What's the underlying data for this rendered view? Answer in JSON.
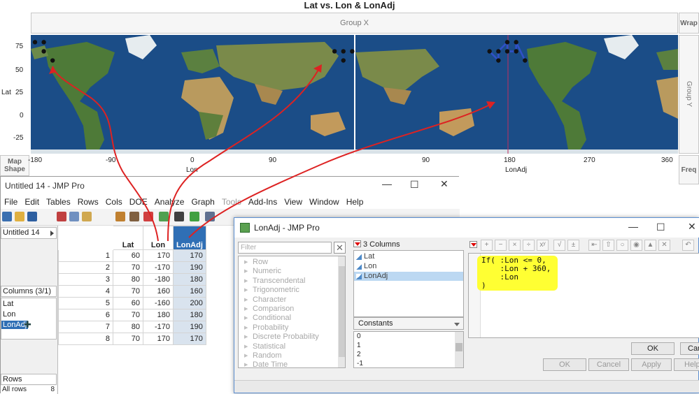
{
  "graph": {
    "title": "Lat vs. Lon & LonAdj",
    "group_x": "Group X",
    "group_y": "Group Y",
    "wrap": "Wrap",
    "freq": "Freq",
    "map_shape": "Map Shape",
    "y_label": "Lat",
    "y_ticks": [
      "75",
      "50",
      "25",
      "0",
      "-25"
    ],
    "x1_label": "Lon",
    "x1_ticks": [
      "-180",
      "-90",
      "0",
      "90"
    ],
    "x2_label": "LonAdj",
    "x2_ticks": [
      "90",
      "180",
      "270",
      "360"
    ],
    "ocean_color": "#1b4d87",
    "point_color": "#111111",
    "line_color": "#3050c8",
    "arrow_color": "#dd2222",
    "lon_points": [
      {
        "lon": 170,
        "lat": 60
      },
      {
        "lon": -170,
        "lat": 70
      },
      {
        "lon": -180,
        "lat": 80
      },
      {
        "lon": 160,
        "lat": 70
      },
      {
        "lon": -160,
        "lat": 60
      },
      {
        "lon": 180,
        "lat": 70
      },
      {
        "lon": -170,
        "lat": 80
      },
      {
        "lon": 170,
        "lat": 70
      }
    ],
    "lonadj_points": [
      {
        "lon": 170,
        "lat": 60
      },
      {
        "lon": 190,
        "lat": 70
      },
      {
        "lon": 180,
        "lat": 80
      },
      {
        "lon": 160,
        "lat": 70
      },
      {
        "lon": 200,
        "lat": 60
      },
      {
        "lon": 180,
        "lat": 70
      },
      {
        "lon": 190,
        "lat": 80
      },
      {
        "lon": 170,
        "lat": 70
      }
    ]
  },
  "data_table": {
    "title": "Untitled 14 - JMP Pro",
    "menu": [
      {
        "label": "File",
        "disabled": false
      },
      {
        "label": "Edit",
        "disabled": false
      },
      {
        "label": "Tables",
        "disabled": false
      },
      {
        "label": "Rows",
        "disabled": false
      },
      {
        "label": "Cols",
        "disabled": false
      },
      {
        "label": "DOE",
        "disabled": false
      },
      {
        "label": "Analyze",
        "disabled": false
      },
      {
        "label": "Graph",
        "disabled": false
      },
      {
        "label": "Tools",
        "disabled": true
      },
      {
        "label": "Add-Ins",
        "disabled": false
      },
      {
        "label": "View",
        "disabled": false
      },
      {
        "label": "Window",
        "disabled": false
      },
      {
        "label": "Help",
        "disabled": false
      }
    ],
    "table_name": "Untitled 14",
    "columns_header": "Columns (3/1)",
    "column_list": [
      "Lat",
      "Lon",
      "LonAdj"
    ],
    "rows_header": "Rows",
    "rows_label": "All rows",
    "rows_count": "8",
    "headers": [
      "Lat",
      "Lon",
      "LonAdj"
    ],
    "rows": [
      [
        60,
        170,
        170
      ],
      [
        70,
        -170,
        190
      ],
      [
        80,
        -180,
        180
      ],
      [
        70,
        160,
        160
      ],
      [
        60,
        -160,
        200
      ],
      [
        70,
        180,
        180
      ],
      [
        80,
        -170,
        190
      ],
      [
        70,
        170,
        170
      ]
    ],
    "selected_color": "#2f6fb5"
  },
  "formula_dialog": {
    "title": "LonAdj - JMP Pro",
    "filter_placeholder": "Filter",
    "functions": [
      "Row",
      "Numeric",
      "Transcendental",
      "Trigonometric",
      "Character",
      "Comparison",
      "Conditional",
      "Probability",
      "Discrete Probability",
      "Statistical",
      "Random",
      "Date Time"
    ],
    "columns_header": "3 Columns",
    "columns": [
      "Lat",
      "Lon",
      "LonAdj"
    ],
    "constants_label": "Constants",
    "constants": [
      "0",
      "1",
      "2",
      "-1"
    ],
    "formula_lines": [
      "If( :Lon <= 0,",
      "    :Lon + 360,",
      "    :Lon",
      ")"
    ],
    "highlight_color": "#ffff33",
    "buttons": {
      "ok_inner": "OK",
      "cancel_inner": "Cance",
      "ok": "OK",
      "cancel": "Cancel",
      "apply": "Apply",
      "help": "Help"
    }
  }
}
